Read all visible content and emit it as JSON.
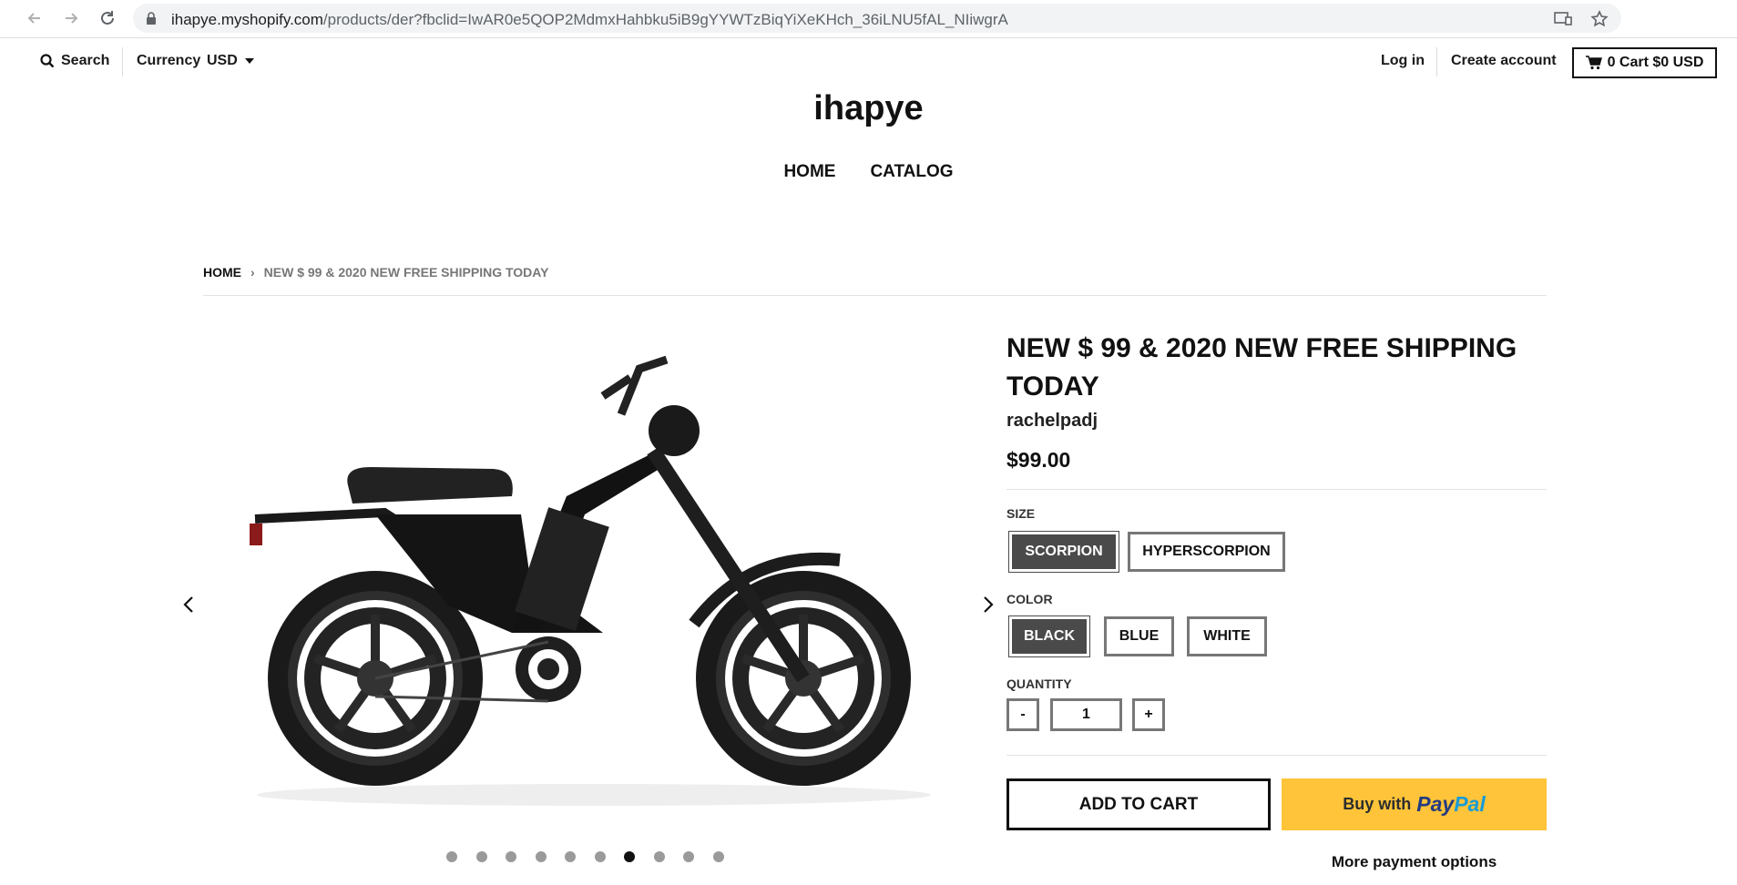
{
  "browser": {
    "url_host": "ihapye.myshopify.com",
    "url_path": "/products/der?fbclid=IwAR0e5QOP2MdmxHahbku5iB9gYYWTzBiqYiXeKHch_36iLNU5fAL_NIiwgrA"
  },
  "topbar": {
    "search_label": "Search",
    "currency_label": "Currency",
    "currency_value": "USD",
    "login_label": "Log in",
    "create_account_label": "Create account",
    "cart_label": "0 Cart $0 USD"
  },
  "store": {
    "name": "ihapye"
  },
  "nav": {
    "items": [
      {
        "label": "HOME"
      },
      {
        "label": "CATALOG"
      }
    ]
  },
  "breadcrumb": {
    "home": "HOME",
    "separator": "›",
    "current": "NEW $ 99 & 2020 NEW FREE SHIPPING TODAY"
  },
  "gallery": {
    "image_alt": "Black electric moped bike",
    "slide_count": 10,
    "active_slide": 7
  },
  "product": {
    "title": "NEW $ 99 & 2020 NEW FREE SHIPPING TODAY",
    "vendor": "rachelpadj",
    "price": "$99.00",
    "size": {
      "label": "SIZE",
      "options": [
        "SCORPION",
        "HYPERSCORPION"
      ],
      "selected": "SCORPION"
    },
    "color": {
      "label": "COLOR",
      "options": [
        "BLACK",
        "BLUE",
        "WHITE"
      ],
      "selected": "BLACK"
    },
    "quantity": {
      "label": "QUANTITY",
      "decrement": "-",
      "value": "1",
      "increment": "+"
    },
    "add_to_cart": "ADD TO CART",
    "paypal": {
      "prefix": "Buy with",
      "brand_part1": "Pay",
      "brand_part2": "Pal"
    },
    "more_payment": "More payment options"
  },
  "colors": {
    "paypal_yellow": "#ffc439",
    "selected_swatch": "#4a4a4a"
  }
}
